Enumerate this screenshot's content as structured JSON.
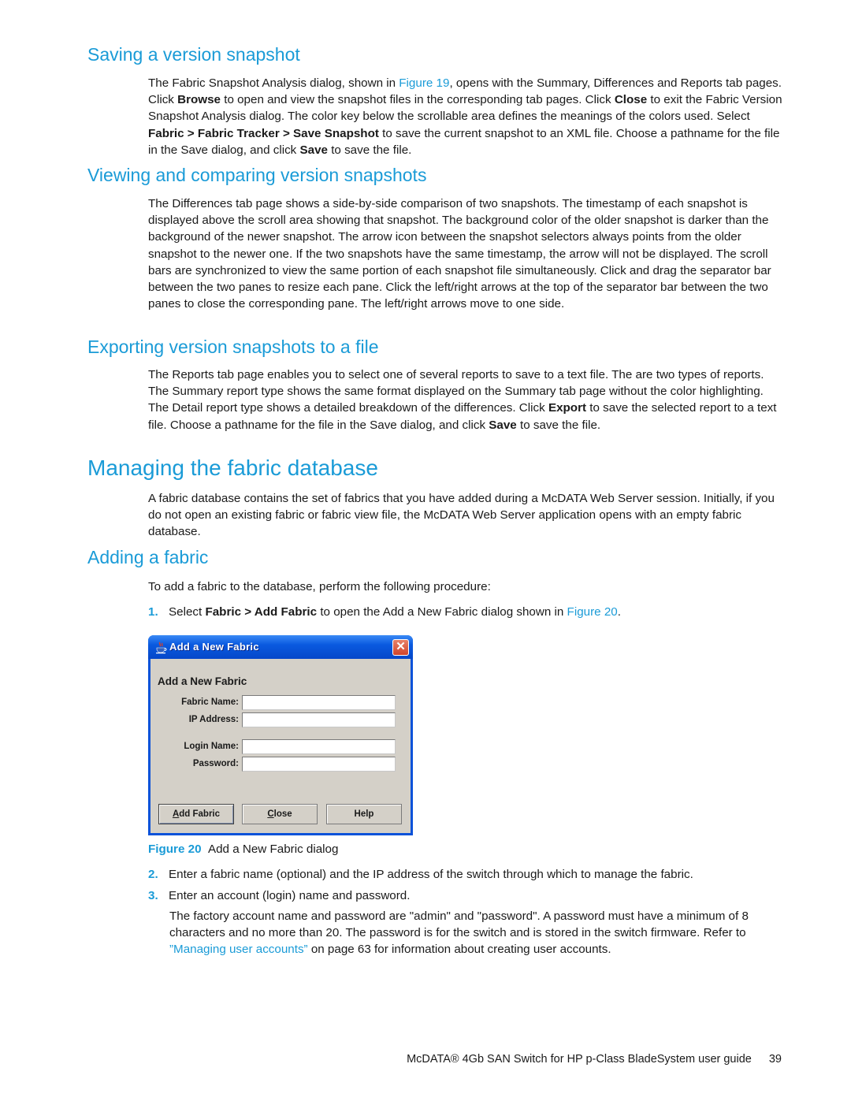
{
  "sections": {
    "saving": {
      "heading": "Saving a version snapshot",
      "p": [
        "The Fabric Snapshot Analysis dialog, shown in ",
        "Figure 19",
        ", opens with the Summary, Differences and Reports tab pages. Click ",
        "Browse",
        " to open and view the snapshot files in the corresponding tab pages. Click ",
        "Close",
        " to exit the Fabric Version Snapshot Analysis dialog. The color key below the scrollable area defines the meanings of the colors used. Select ",
        "Fabric > Fabric Tracker > Save Snapshot",
        " to save the current snapshot to an XML file. Choose a pathname for the file in the Save dialog, and click ",
        "Save",
        " to save the file."
      ]
    },
    "viewing": {
      "heading": "Viewing and comparing version snapshots",
      "p": "The Differences tab page shows a side-by-side comparison of two snapshots. The timestamp of each snapshot is displayed above the scroll area showing that snapshot. The background color of the older snapshot is darker than the background of the newer snapshot. The arrow icon between the snapshot selectors always points from the older snapshot to the newer one. If the two snapshots have the same timestamp, the arrow will not be displayed. The scroll bars are synchronized to view the same portion of each snapshot file simultaneously. Click and drag the separator bar between the two panes to resize each pane. Click the left/right arrows at the top of the separator bar between the two panes to close the corresponding pane. The left/right arrows move to one side."
    },
    "exporting": {
      "heading": "Exporting version snapshots to a file",
      "p": [
        "The Reports tab page enables you to select one of several reports to save to a text file. The are two types of reports. The Summary report type shows the same format displayed on the Summary tab page without the color highlighting. The Detail report type shows a detailed breakdown of the differences. Click ",
        "Export",
        " to save the selected report to a text file. Choose a pathname for the file in the Save dialog, and click ",
        "Save",
        " to save the file."
      ]
    },
    "managing": {
      "heading": "Managing the fabric database",
      "p": "A fabric database contains the set of fabrics that you have added during a McDATA Web Server session. Initially, if you do not open an existing fabric or fabric view file, the McDATA Web Server application opens with an empty fabric database."
    },
    "adding": {
      "heading": "Adding a fabric",
      "intro": "To add a fabric to the database, perform the following procedure:",
      "step1": {
        "num": "1.",
        "parts": [
          "Select ",
          "Fabric > Add Fabric",
          " to open the Add a New Fabric dialog shown in ",
          "Figure 20",
          "."
        ]
      },
      "step2": {
        "num": "2.",
        "text": "Enter a fabric name (optional) and the IP address of the switch through which to manage the fabric."
      },
      "step3": {
        "num": "3.",
        "text": "Enter an account (login) name and password."
      },
      "note": {
        "parts": [
          "The factory account name and password are \"admin\" and \"password\". A password must have a minimum of 8 characters and no more than 20. The password is for the switch and is stored in the switch firmware. Refer to ",
          "”Managing user accounts”",
          " on page 63 for information about creating user accounts."
        ]
      }
    }
  },
  "dialog": {
    "title": "Add a New Fabric",
    "heading": "Add a New Fabric",
    "fields": {
      "fabric_name": {
        "label": "Fabric Name:",
        "value": ""
      },
      "ip_address": {
        "label": "IP Address:",
        "value": ""
      },
      "login_name": {
        "label": "Login Name:",
        "value": ""
      },
      "password": {
        "label": "Password:",
        "value": ""
      }
    },
    "buttons": {
      "add_fabric": {
        "mnemonic": "A",
        "rest": "dd Fabric"
      },
      "close": {
        "mnemonic": "C",
        "rest": "lose"
      },
      "help": {
        "label": "Help"
      }
    },
    "close_glyph": "✕"
  },
  "figure": {
    "label": "Figure 20",
    "caption": "Add a New Fabric dialog"
  },
  "footer": {
    "guide_title": "McDATA® 4Gb SAN Switch for HP p-Class BladeSystem user guide",
    "page_number": "39"
  },
  "colors": {
    "accent": "#1a9bd7",
    "text": "#1a1a1a",
    "dialog_frame": "#0a52d9",
    "dialog_face": "#d4d0c8"
  }
}
